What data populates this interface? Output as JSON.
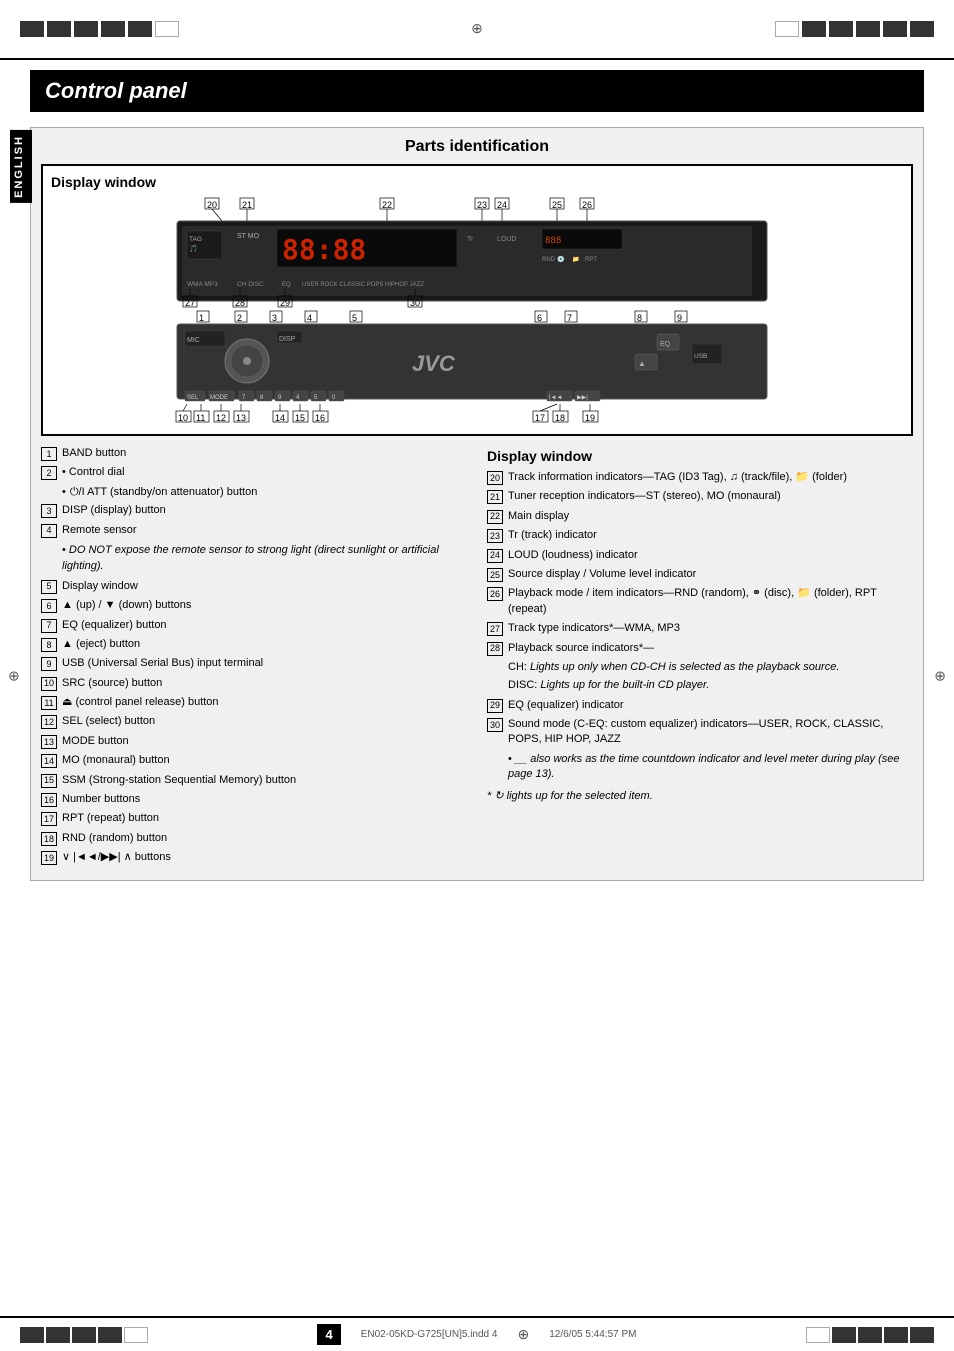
{
  "page": {
    "title": "Control panel",
    "subtitle": "Parts identification",
    "display_window_title": "Display window",
    "language_label": "ENGLISH",
    "page_number": "4",
    "file_info": "EN02-05KD-G725[UN]5.indd  4",
    "date_info": "12/6/05  5:44:57 PM"
  },
  "left_descriptions": [
    {
      "num": "1",
      "text": "BAND button"
    },
    {
      "num": "2",
      "text": "• Control dial"
    },
    {
      "num": "2a",
      "text": "• ⏻/I ATT (standby/on attenuator) button",
      "sub": true
    },
    {
      "num": "3",
      "text": "DISP (display) button"
    },
    {
      "num": "4",
      "text": "Remote sensor"
    },
    {
      "num": "4a",
      "text": "• DO NOT expose the remote sensor to strong light (direct sunlight or artificial lighting).",
      "italic": true,
      "sub": true
    },
    {
      "num": "5",
      "text": "Display window"
    },
    {
      "num": "6",
      "text": "▲ (up) / ▼ (down) buttons"
    },
    {
      "num": "7",
      "text": "EQ (equalizer) button"
    },
    {
      "num": "8",
      "text": "▲ (eject) button"
    },
    {
      "num": "9",
      "text": "USB (Universal Serial Bus) input terminal"
    },
    {
      "num": "10",
      "text": "SRC (source) button"
    },
    {
      "num": "11",
      "text": "⏏ (control panel release) button"
    },
    {
      "num": "12",
      "text": "SEL (select) button"
    },
    {
      "num": "13",
      "text": "MODE button"
    },
    {
      "num": "14",
      "text": "MO (monaural) button"
    },
    {
      "num": "15",
      "text": "SSM (Strong-station Sequential Memory) button"
    },
    {
      "num": "16",
      "text": "Number buttons"
    },
    {
      "num": "17",
      "text": "RPT (repeat) button"
    },
    {
      "num": "18",
      "text": "RND (random) button"
    },
    {
      "num": "19",
      "text": "∨ |◄◄/▶▶| ∧ buttons"
    }
  ],
  "right_descriptions_title": "Display window",
  "right_descriptions": [
    {
      "num": "20",
      "text": "Track information indicators—TAG (ID3 Tag), 🎵 (track/file), 📁 (folder)"
    },
    {
      "num": "21",
      "text": "Tuner reception indicators—ST (stereo), MO (monaural)"
    },
    {
      "num": "22",
      "text": "Main display"
    },
    {
      "num": "23",
      "text": "Tr (track) indicator"
    },
    {
      "num": "24",
      "text": "LOUD (loudness) indicator"
    },
    {
      "num": "25",
      "text": "Source display / Volume level indicator"
    },
    {
      "num": "26",
      "text": "Playback mode / item indicators—RND (random), 💿 (disc), 📁 (folder), RPT (repeat)"
    },
    {
      "num": "27",
      "text": "Track type indicators*—WMA, MP3"
    },
    {
      "num": "28",
      "text": "Playback source indicators*—"
    },
    {
      "num": "28a",
      "text": "CH: Lights up only when CD-CH is selected as the playback source.",
      "italic": true
    },
    {
      "num": "28b",
      "text": "DISC: Lights up for the built-in CD player.",
      "italic": true
    },
    {
      "num": "29",
      "text": "EQ (equalizer) indicator"
    },
    {
      "num": "30",
      "text": "Sound mode (C-EQ: custom equalizer) indicators—USER, ROCK, CLASSIC, POPS, HIP HOP, JAZZ"
    },
    {
      "num": "30a",
      "text": "• __ also works as the time countdown indicator and level meter during play (see page 13).",
      "italic": true
    },
    {
      "num": "foot",
      "text": "* 🔄 lights up for the selected item.",
      "italic": true
    }
  ],
  "panel_numbers_top": [
    "20",
    "21",
    "22",
    "23",
    "24",
    "25",
    "26"
  ],
  "panel_numbers_bottom_left": [
    "1",
    "2",
    "3",
    "4",
    "5",
    "6",
    "7",
    "8",
    "9"
  ],
  "panel_numbers_bottom": [
    "10",
    "11",
    "12",
    "13",
    "14",
    "15",
    "16",
    "17",
    "18",
    "19"
  ],
  "display_labels": {
    "tag": "TAG",
    "loud": "LOUD",
    "st_mo": "ST MO",
    "rnd": "RND",
    "rpt": "RPT",
    "wma": "WMA",
    "mp3": "MP3",
    "ch": "CH",
    "disc": "DISC",
    "eq": "EQ",
    "user": "USER",
    "rock": "ROCK",
    "classic": "CLASSIC",
    "pops": "POPS",
    "hiphop": "HIPHOP",
    "jazz": "JAZZ",
    "jvc": "JVC"
  }
}
